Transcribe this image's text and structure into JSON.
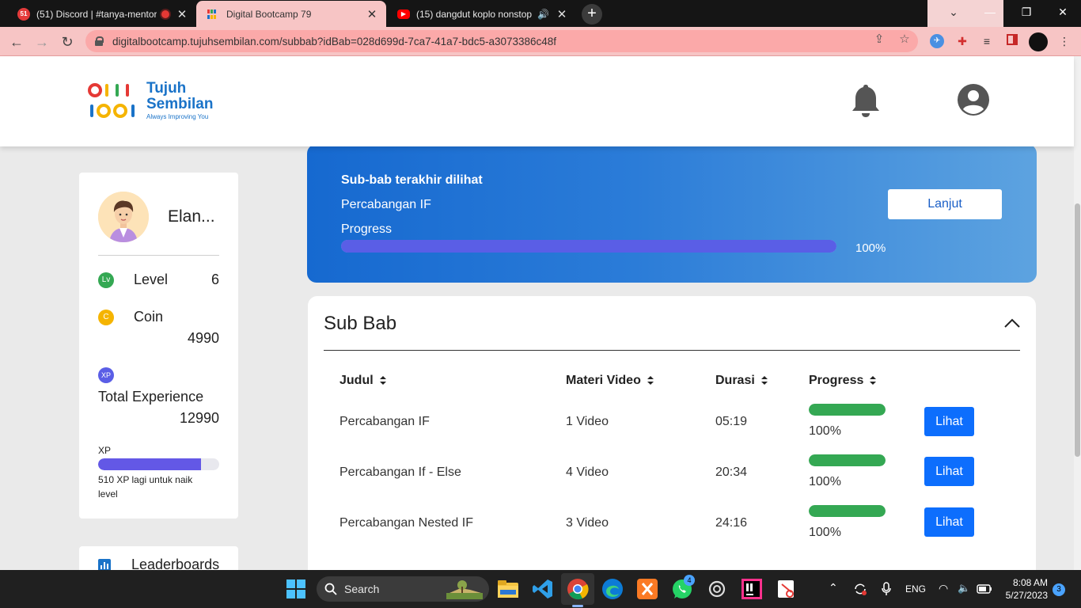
{
  "browser": {
    "tabs": [
      {
        "title": "(51) Discord | #tanya-mentor",
        "favicon_badge": "51",
        "active": false
      },
      {
        "title": "Digital Bootcamp 79",
        "active": true
      },
      {
        "title": "(15) dangdut koplo nonstop",
        "active": false
      }
    ],
    "url": "digitalbootcamp.tujuhsembilan.com/subbab?idBab=028d699d-7ca7-41a7-bdc5-a3073386c48f"
  },
  "header": {
    "brand_line1": "Tujuh",
    "brand_line2": "Sembilan",
    "tagline": "Always Improving You"
  },
  "profile": {
    "name": "Elan...",
    "level_icon": "Lv",
    "level_label": "Level",
    "level_value": "6",
    "coin_icon": "C",
    "coin_label": "Coin",
    "coin_value": "4990",
    "xp_icon": "XP",
    "experience_label": "Total Experience",
    "experience_value": "12990",
    "xp_caption": "XP",
    "xp_progress": 0.85,
    "xp_note": "510 XP lagi untuk naik level"
  },
  "leaderboard": {
    "label": "Leaderboards"
  },
  "last_seen": {
    "heading": "Sub-bab terakhir dilihat",
    "subchapter": "Percabangan IF",
    "progress_label": "Progress",
    "progress": 100,
    "progress_text": "100%",
    "continue_label": "Lanjut"
  },
  "subbab": {
    "title": "Sub Bab",
    "columns": [
      "Judul",
      "Materi Video",
      "Durasi",
      "Progress"
    ],
    "rows": [
      {
        "judul": "Percabangan IF",
        "materi": "1 Video",
        "durasi": "05:19",
        "progress": 100,
        "progress_text": "100%",
        "action": "Lihat"
      },
      {
        "judul": "Percabangan If - Else",
        "materi": "4 Video",
        "durasi": "20:34",
        "progress": 100,
        "progress_text": "100%",
        "action": "Lihat"
      },
      {
        "judul": "Percabangan Nested IF",
        "materi": "3 Video",
        "durasi": "24:16",
        "progress": 100,
        "progress_text": "100%",
        "action": "Lihat"
      }
    ]
  },
  "taskbar": {
    "search_label": "Search",
    "whatsapp_badge": "4",
    "language": "ENG",
    "time": "8:08 AM",
    "date": "5/27/2023",
    "notification_count": "3"
  },
  "colors": {
    "brand_blue": "#1a73c8",
    "banner_start": "#1669d0",
    "banner_end": "#5da3e0",
    "progress_purple": "#5a5ee6",
    "progress_green": "#34a853",
    "button_blue": "#0d6efd",
    "tab_active": "#f7c5c5"
  }
}
